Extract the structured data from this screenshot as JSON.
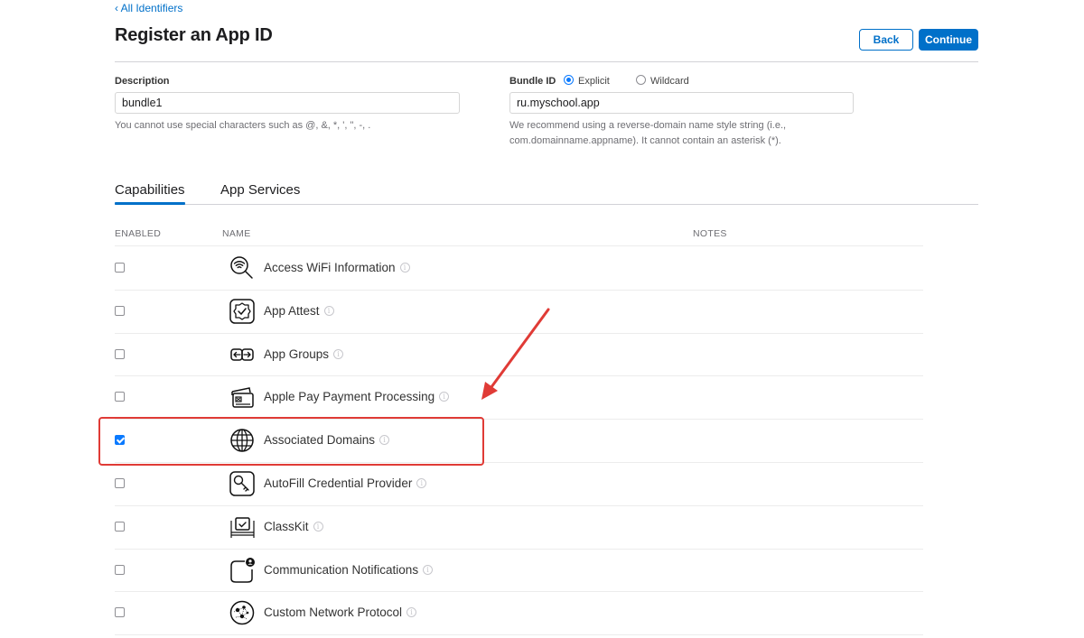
{
  "nav": {
    "back_link": "‹ All Identifiers"
  },
  "header": {
    "title": "Register an App ID",
    "back_label": "Back",
    "continue_label": "Continue"
  },
  "form": {
    "description": {
      "label": "Description",
      "value": "bundle1",
      "help": "You cannot use special characters such as @, &, *, ', \", -, ."
    },
    "bundle_id": {
      "label": "Bundle ID",
      "options": [
        {
          "label": "Explicit",
          "selected": true
        },
        {
          "label": "Wildcard",
          "selected": false
        }
      ],
      "value": "ru.myschool.app",
      "help_line1": "We recommend using a reverse-domain name style string (i.e.,",
      "help_line2": "com.domainname.appname). It cannot contain an asterisk (*)."
    }
  },
  "tabs": [
    {
      "label": "Capabilities",
      "active": true
    },
    {
      "label": "App Services",
      "active": false
    }
  ],
  "table": {
    "columns": [
      "ENABLED",
      "NAME",
      "NOTES"
    ],
    "rows": [
      {
        "name": "Access WiFi Information",
        "enabled": false,
        "icon": "wifi-search-icon"
      },
      {
        "name": "App Attest",
        "enabled": false,
        "icon": "badge-check-icon"
      },
      {
        "name": "App Groups",
        "enabled": false,
        "icon": "app-groups-icon"
      },
      {
        "name": "Apple Pay Payment Processing",
        "enabled": false,
        "icon": "credit-card-icon"
      },
      {
        "name": "Associated Domains",
        "enabled": true,
        "icon": "globe-icon"
      },
      {
        "name": "AutoFill Credential Provider",
        "enabled": false,
        "icon": "key-icon"
      },
      {
        "name": "ClassKit",
        "enabled": false,
        "icon": "classkit-icon"
      },
      {
        "name": "Communication Notifications",
        "enabled": false,
        "icon": "notification-person-icon"
      },
      {
        "name": "Custom Network Protocol",
        "enabled": false,
        "icon": "network-protocol-icon"
      }
    ]
  },
  "annotation": {
    "color": "#e03b36",
    "highlighted_row": "Associated Domains"
  },
  "colors": {
    "accent": "#0070c9",
    "checkbox": "#0a7aff"
  }
}
